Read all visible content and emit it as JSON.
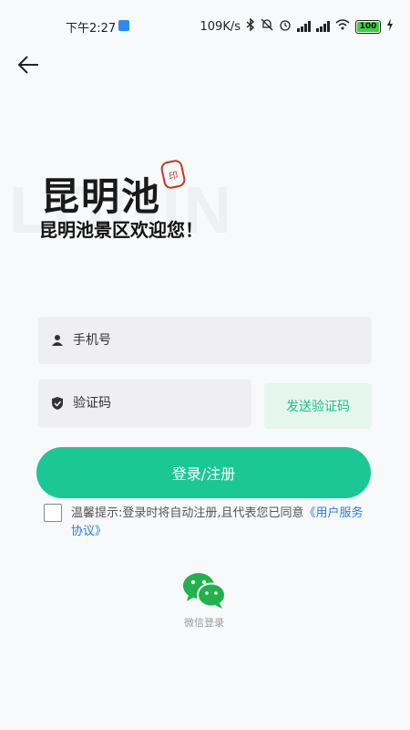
{
  "status_bar": {
    "time": "下午2:27",
    "network_speed": "109K/s",
    "battery": "100"
  },
  "brand": {
    "title": "昆明池",
    "watermark": "LOGIN",
    "welcome": "昆明池景区欢迎您！"
  },
  "form": {
    "phone_placeholder": "手机号",
    "code_placeholder": "验证码",
    "send_code_label": "发送验证码",
    "submit_label": "登录/注册"
  },
  "agreement": {
    "prefix": "温馨提示:登录时将自动注册,且代表您已同意",
    "link": "《用户服务协议》"
  },
  "social": {
    "wechat_label": "微信登录"
  },
  "colors": {
    "accent": "#1cc796",
    "accent_light": "#e4f6ee",
    "link": "#2b7be0"
  }
}
